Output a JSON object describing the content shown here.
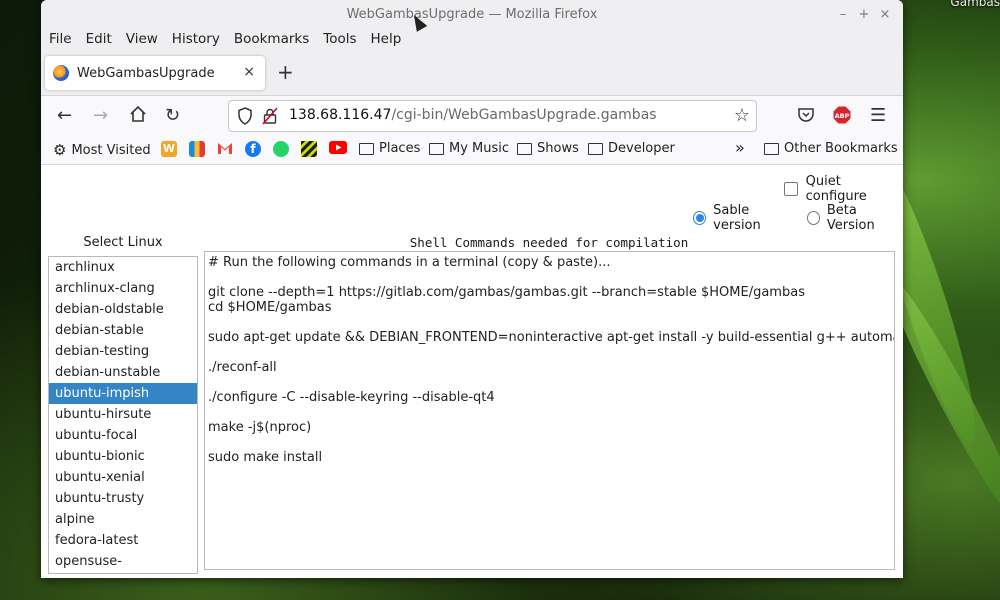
{
  "desktop": {
    "corner_label": "Gambas"
  },
  "window": {
    "title": "WebGambasUpgrade — Mozilla Firefox",
    "minimize": "–",
    "maximize": "+",
    "close": "×"
  },
  "menu": [
    "File",
    "Edit",
    "View",
    "History",
    "Bookmarks",
    "Tools",
    "Help"
  ],
  "tab": {
    "title": "WebGambasUpgrade",
    "close": "×",
    "new_tab": "+"
  },
  "url": {
    "host": "138.68.116.47",
    "path": "/cgi-bin/WebGambasUpgrade.gambas"
  },
  "bookmarks": {
    "most_visited": "Most Visited",
    "folders": [
      "Places",
      "My Music",
      "Shows",
      "Developer"
    ],
    "other": "Other Bookmarks",
    "overflow": "»"
  },
  "options": {
    "quiet_label": "Quiet configure",
    "quiet_checked": false,
    "sable_label": "Sable version",
    "beta_label": "Beta Version",
    "selected_version": "Sable version"
  },
  "linux_list": {
    "title": "Select Linux",
    "selected": "ubuntu-impish",
    "items": [
      "archlinux",
      "archlinux-clang",
      "debian-oldstable",
      "debian-stable",
      "debian-testing",
      "debian-unstable",
      "ubuntu-impish",
      "ubuntu-hirsute",
      "ubuntu-focal",
      "ubuntu-bionic",
      "ubuntu-xenial",
      "ubuntu-trusty",
      "alpine",
      "fedora-latest",
      "opensuse-tumbleweed"
    ]
  },
  "shell": {
    "title": "Shell Commands needed for compilation",
    "lines": [
      "# Run the following commands in a terminal (copy & paste)...",
      "",
      "git clone --depth=1 https://gitlab.com/gambas/gambas.git --branch=stable $HOME/gambas",
      "cd $HOME/gambas",
      "",
      "sudo apt-get update && DEBIAN_FRONTEND=noninteractive apt-get install -y build-essential g++ automake autoconf",
      "",
      "./reconf-all",
      "",
      "./configure -C --disable-keyring --disable-qt4",
      "",
      "make -j$(nproc)",
      "",
      "sudo make install"
    ]
  }
}
